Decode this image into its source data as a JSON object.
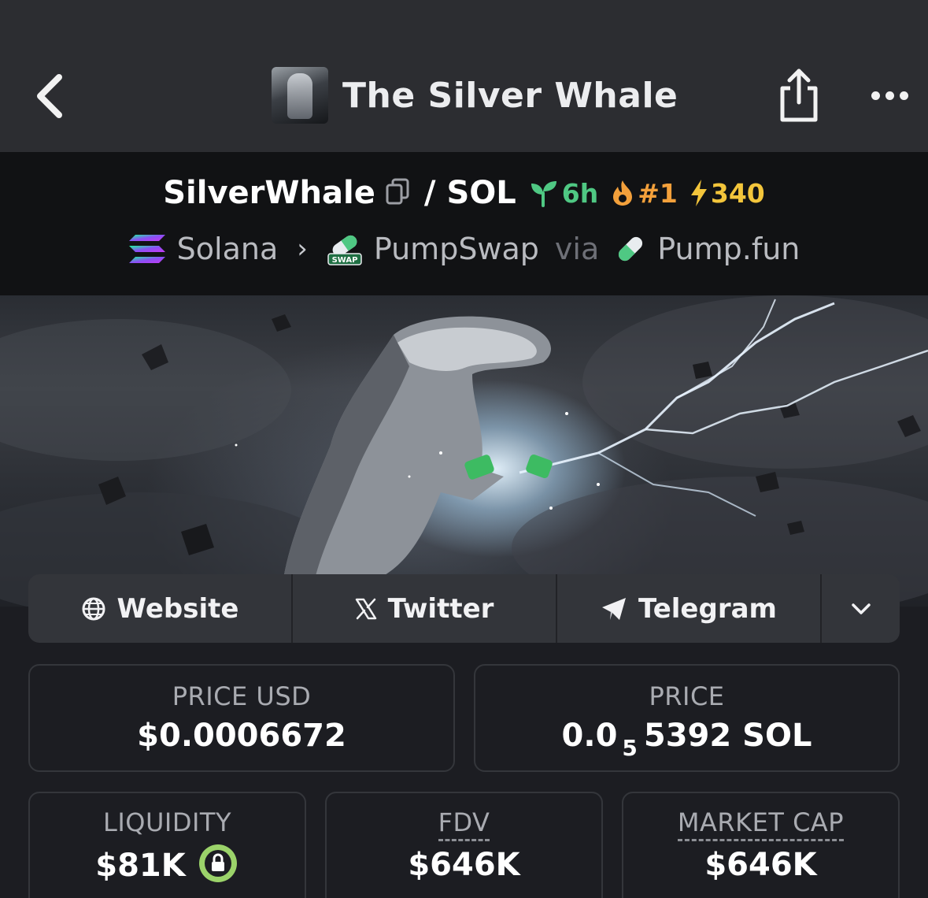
{
  "nav": {
    "title": "The Silver Whale"
  },
  "pair": {
    "base_symbol": "SilverWhale",
    "separator": "/",
    "quote_symbol": "SOL",
    "age": "6h",
    "rank": "#1",
    "boosts": "340"
  },
  "chain": {
    "chain_name": "Solana",
    "dex_name": "PumpSwap",
    "via_label": "via",
    "launchpad_name": "Pump.fun"
  },
  "links": {
    "website_label": "Website",
    "twitter_label": "Twitter",
    "telegram_label": "Telegram"
  },
  "stats": {
    "price_usd_label": "PRICE USD",
    "price_usd_value": "$0.0006672",
    "price_label": "PRICE",
    "price_prefix": "0.0",
    "price_zero_count": "5",
    "price_digits": "5392 SOL",
    "liquidity_label": "LIQUIDITY",
    "liquidity_value": "$81K",
    "fdv_label": "FDV",
    "fdv_value": "$646K",
    "market_cap_label": "MARKET CAP",
    "market_cap_value": "$646K"
  },
  "colors": {
    "accent_green": "#4fc883",
    "accent_orange": "#f3a03b",
    "accent_yellow": "#f3c53b",
    "lock_green": "#9bd36a"
  },
  "icons": [
    "chevron-left-icon",
    "share-icon",
    "more-icon",
    "copy-icon",
    "seedling-icon",
    "flame-icon",
    "bolt-icon",
    "solana-icon",
    "pumpswap-icon",
    "pill-icon",
    "globe-icon",
    "x-icon",
    "telegram-icon",
    "chevron-down-icon",
    "lock-icon"
  ]
}
